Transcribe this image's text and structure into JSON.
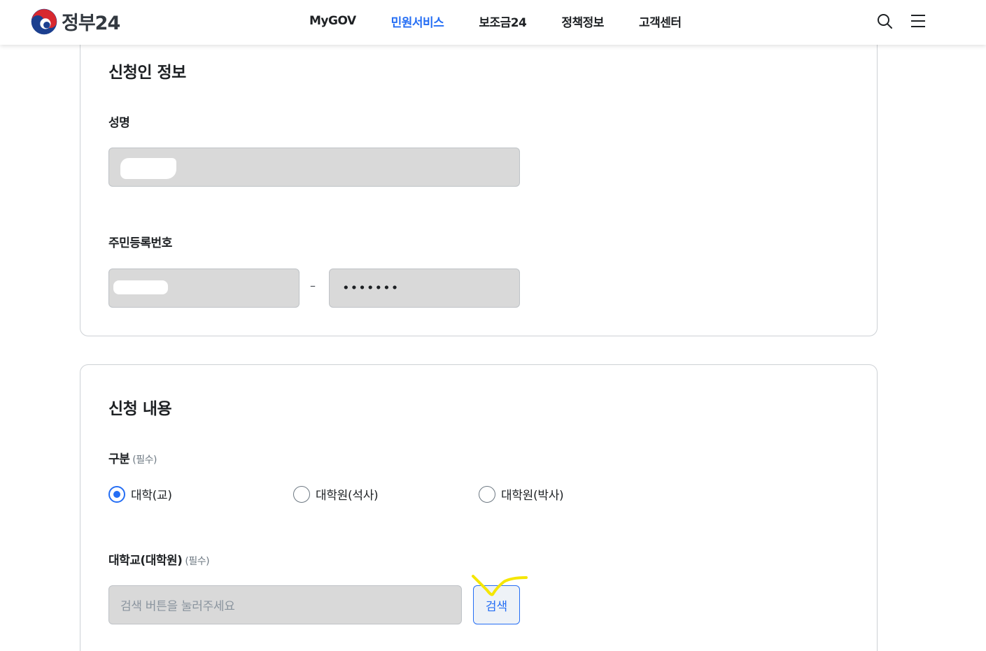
{
  "header": {
    "logo_text": "정부24",
    "nav": [
      "MyGOV",
      "민원서비스",
      "보조금24",
      "정책정보",
      "고객센터"
    ],
    "active_nav": "민원서비스",
    "accent_color": "#256ef4"
  },
  "applicant": {
    "title": "신청인 정보",
    "name_label": "성명",
    "rrn_label": "주민등록번호",
    "rrn_separator": "–",
    "rrn_back_masked": "•••••••"
  },
  "application": {
    "title": "신청 내용",
    "category_label": "구분",
    "required_text": "(필수)",
    "options": [
      "대학(교)",
      "대학원(석사)",
      "대학원(박사)"
    ],
    "selected_option": "대학(교)",
    "school_label": "대학교(대학원)",
    "school_placeholder": "검색 버튼을 눌러주세요",
    "search_button": "검색"
  }
}
